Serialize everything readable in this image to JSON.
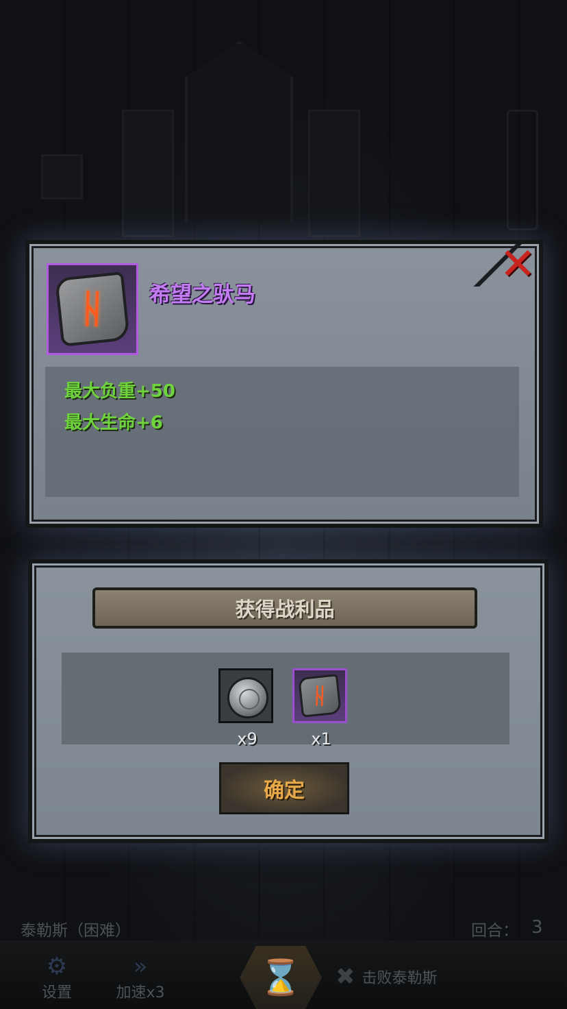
{
  "item": {
    "name": "希望之驮马",
    "rune_symbol": "ᚺ",
    "stats": [
      "最大负重+50",
      "最大生命+6"
    ]
  },
  "close_symbol": "✕",
  "loot": {
    "title": "获得战利品",
    "items": [
      {
        "icon": "silver-coin-icon",
        "quantity": "x9"
      },
      {
        "icon": "rune-stone-icon",
        "quantity": "x1"
      }
    ],
    "confirm_label": "确定"
  },
  "hud": {
    "boss": "泰勒斯（困难）",
    "round_label": "回合：",
    "round_value": "3",
    "settings_label": "设置",
    "speed_label": "加速x3",
    "defeat_label": "击败泰勒斯"
  },
  "colors": {
    "item_name": "#c47cf2",
    "stat_text": "#6ed33c",
    "close": "#c8231c",
    "confirm_text": "#e8a94a"
  }
}
